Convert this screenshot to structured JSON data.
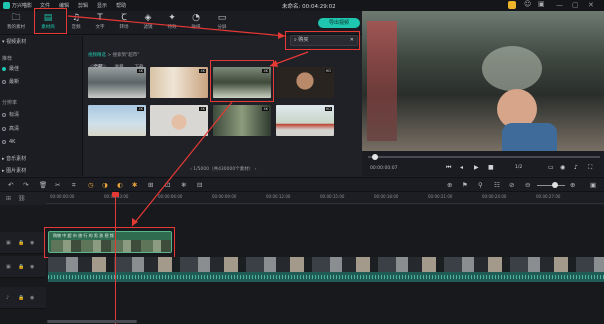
{
  "titlebar": {
    "app_name": "万兴喵影",
    "menu": [
      "文件",
      "编辑",
      "剪辑",
      "显示",
      "帮助"
    ],
    "project": "未命名: 00:04:29:02",
    "window_controls": [
      "—",
      "▢",
      "✕"
    ]
  },
  "toolbar": {
    "items": [
      {
        "label": "我的素材",
        "icon": "folder-icon"
      },
      {
        "label": "素材商",
        "icon": "media-store-icon"
      },
      {
        "label": "音频",
        "icon": "music-note-icon"
      },
      {
        "label": "文字",
        "icon": "text-icon"
      },
      {
        "label": "转场",
        "icon": "transition-icon"
      },
      {
        "label": "滤镜",
        "icon": "filter-icon"
      },
      {
        "label": "特效",
        "icon": "effects-icon"
      },
      {
        "label": "贴纸",
        "icon": "sticker-icon"
      },
      {
        "label": "分屏",
        "icon": "split-screen-icon"
      }
    ],
    "export_label": "导出视频"
  },
  "left_panel": {
    "video_section": "视频素材",
    "recommend": "推荐",
    "filters_1": [
      "最佳",
      "最新"
    ],
    "category_head": "分辨率",
    "filters_2": [
      "标清",
      "高清",
      "4K"
    ],
    "music_section": "音乐素材",
    "image_section": "图片素材"
  },
  "media": {
    "search_value": "购买",
    "breadcrumb_link": "视频精选",
    "breadcrumb_text": "搜索到\"超市\"",
    "tabs": [
      "全部",
      "收藏",
      "下载"
    ],
    "thumb_tags": [
      "4K",
      "4K",
      "4K",
      "HD",
      "4K",
      "4K",
      "4K",
      "HD"
    ],
    "pagination": "1/5000（共430000个素材）"
  },
  "player": {
    "timecode": "00:00:00:07",
    "zoom": "1/2"
  },
  "ruler": {
    "labels": [
      "00:00:00:00",
      "00:00:03:00",
      "00:00:06:00",
      "00:00:09:00",
      "00:00:12:00",
      "00:00:15:00",
      "00:00:18:00",
      "00:00:21:00",
      "00:00:24:00",
      "00:00:27:00"
    ]
  },
  "timeline": {
    "pip_clip_title": "购物 中 超 市 旅 行 的 男 孩 视 频"
  },
  "colors": {
    "accent": "#1fc7b0",
    "highlight": "#e53935"
  }
}
